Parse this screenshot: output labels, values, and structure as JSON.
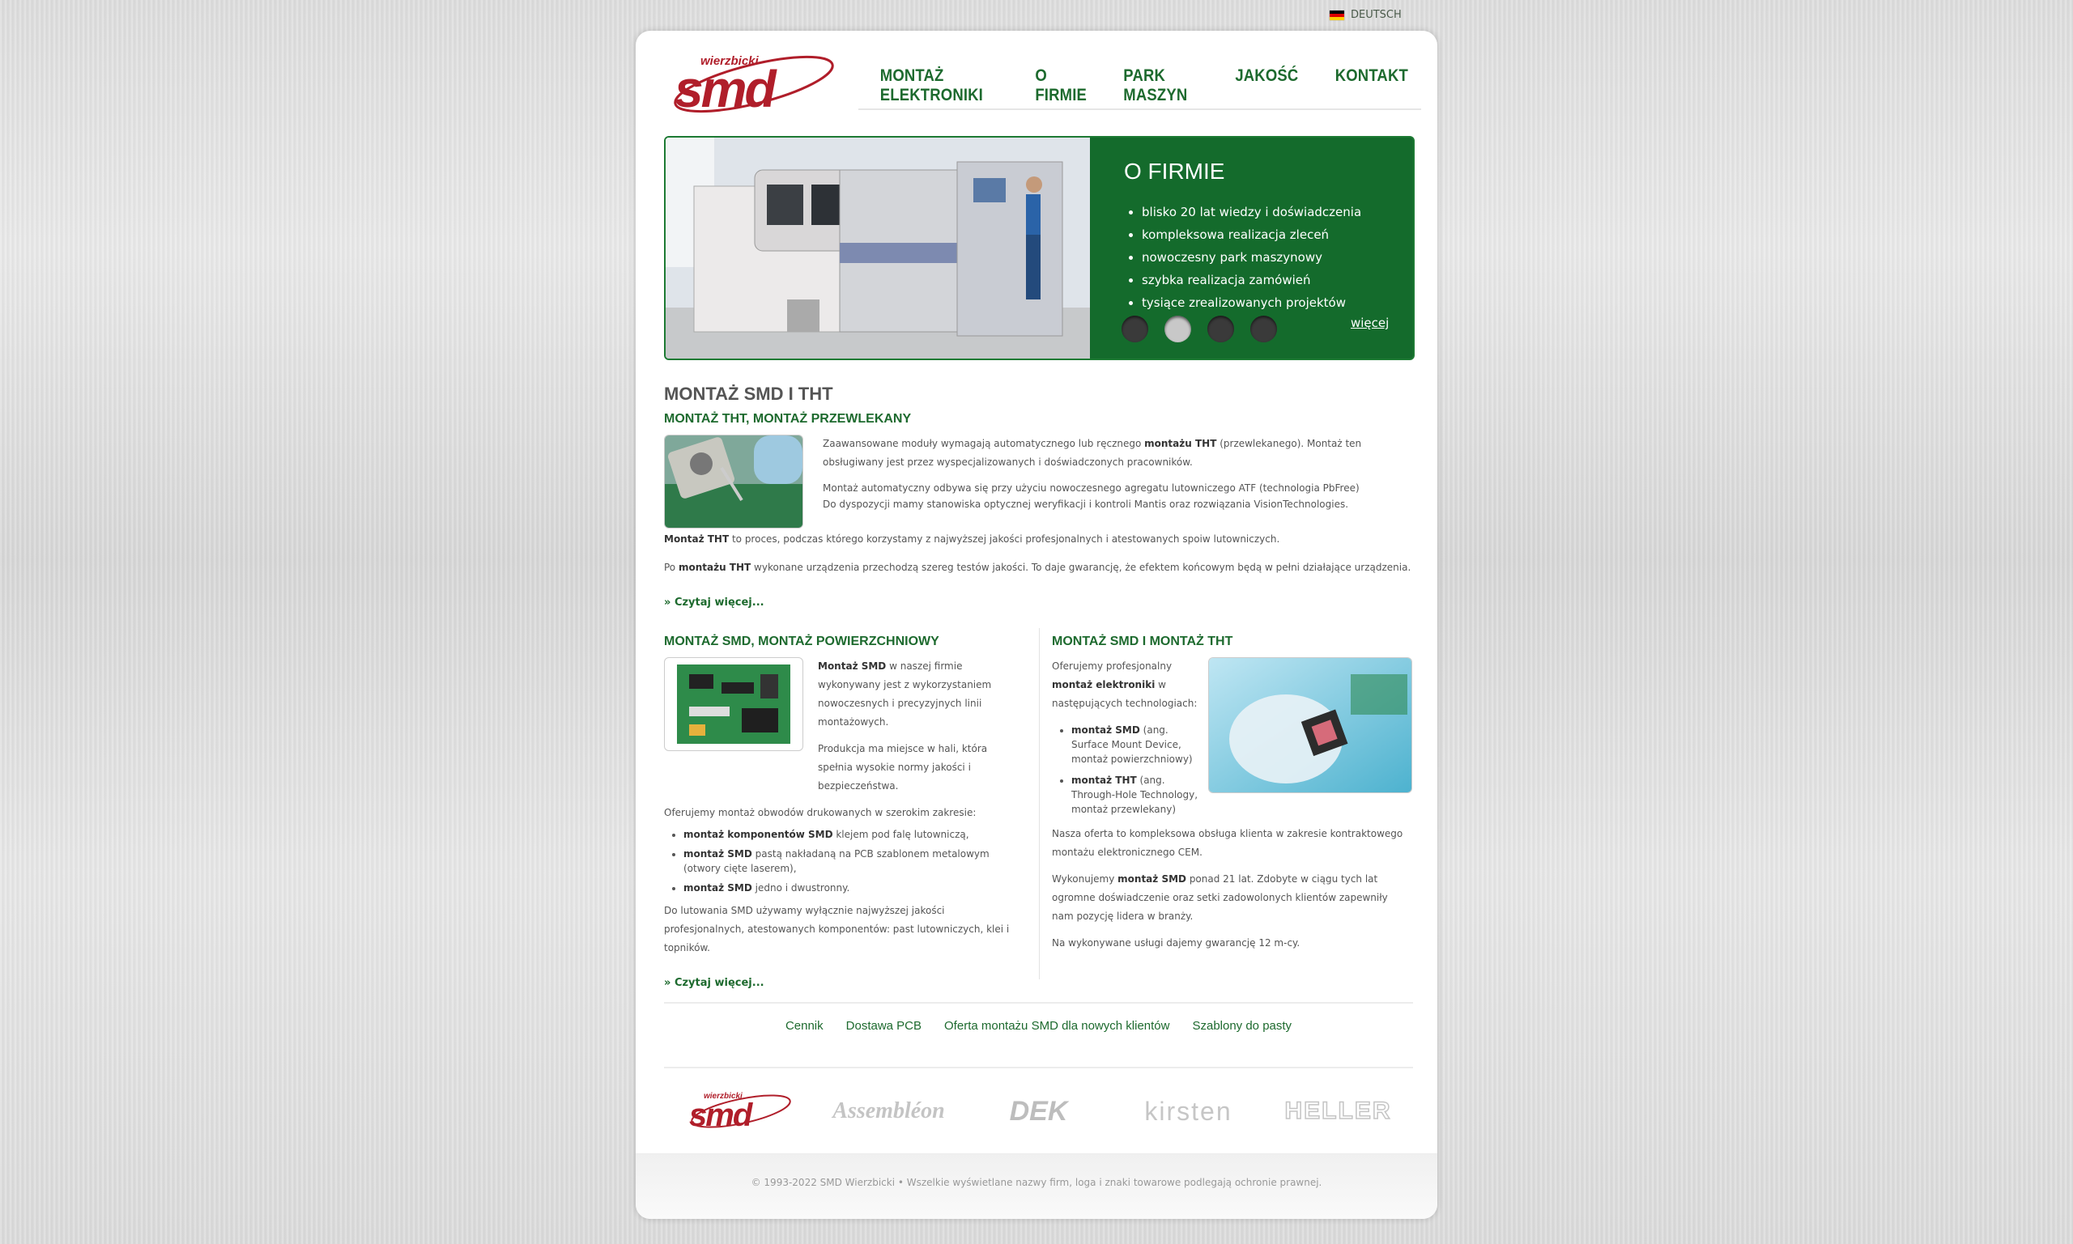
{
  "language": {
    "label": "DEUTSCH",
    "flag_colors": [
      "#000000",
      "#dd0000",
      "#ffce00"
    ]
  },
  "brand": {
    "logo_top": "wierzbicki",
    "logo_main": "smd",
    "accent": "#1d6a2e",
    "logo_red": "#b01e2a"
  },
  "nav": [
    {
      "label": "MONTAŻ ELEKTRONIKI"
    },
    {
      "label": "O FIRMIE"
    },
    {
      "label": "PARK MASZYN"
    },
    {
      "label": "JAKOŚĆ"
    },
    {
      "label": "KONTAKT"
    }
  ],
  "banner": {
    "title": "O FIRMIE",
    "items": [
      "blisko 20 lat wiedzy i doświadczenia",
      "kompleksowa realizacja zleceń",
      "nowoczesny park maszynowy",
      "szybka realizacja zamówień",
      "tysiące zrealizowanych projektów"
    ],
    "more": "więcej",
    "slides": 4,
    "active_slide": 2
  },
  "main": {
    "title": "MONTAŻ SMD I THT",
    "tht": {
      "heading": "MONTAŻ THT, MONTAŻ PRZEWLEKANY",
      "p1_a": "Zaawansowane moduły wymagają automatycznego lub ręcznego ",
      "p1_b": "montażu THT",
      "p1_c": " (przewlekanego). Montaż ten obsługiwany jest przez wyspecjalizowanych i doświadczonych pracowników.",
      "p2_a": "Montaż automatyczny odbywa się przy użyciu nowoczesnego agregatu lutowniczego ATF (technologia PbFree)",
      "p2_b": "Do dyspozycji mamy stanowiska optycznej weryfikacji i kontroli Mantis oraz rozwiązania VisionTechnologies.",
      "p3_b": "Montaż THT",
      "p3_c": " to proces, podczas którego korzystamy z najwyższej jakości profesjonalnych i atestowanych spoiw lutowniczych.",
      "p4_a": "Po ",
      "p4_b": "montażu THT",
      "p4_c": " wykonane urządzenia przechodzą szereg testów jakości. To daje gwarancję, że efektem końcowym będą w pełni działające urządzenia.",
      "read_more": "Czytaj więcej..."
    },
    "smd": {
      "heading": "MONTAŻ SMD, MONTAŻ POWIERZCHNIOWY",
      "p1_b": "Montaż SMD",
      "p1_c": " w naszej firmie wykonywany jest z wykorzystaniem nowoczesnych i precyzyjnych linii montażowych.",
      "p2": "Produkcja ma miejsce w hali, która spełnia wysokie normy jakości i bezpieczeństwa.",
      "p3": "Oferujemy montaż obwodów drukowanych w szerokim zakresie:",
      "list": [
        {
          "b": "montaż komponentów SMD",
          "t": " klejem pod falę lutowniczą,"
        },
        {
          "b": "montaż SMD",
          "t": " pastą nakładaną na PCB szablonem metalowym (otwory cięte laserem),"
        },
        {
          "b": "montaż SMD",
          "t": " jedno i dwustronny."
        }
      ],
      "p4": "Do lutowania SMD używamy wyłącznie najwyższej jakości profesjonalnych, atestowanych komponentów: past lutowniczych, klei i topników.",
      "read_more": "Czytaj więcej..."
    },
    "smdtht": {
      "heading": "MONTAŻ SMD I MONTAŻ THT",
      "p1_a": "Oferujemy profesjonalny ",
      "p1_b": "montaż elektroniki",
      "p1_c": " w następujących technologiach:",
      "list": [
        {
          "b": "montaż SMD",
          "t": " (ang. Surface Mount Device, montaż powierzchniowy)"
        },
        {
          "b": "montaż THT",
          "t": " (ang. Through-Hole Technology, montaż przewlekany)"
        }
      ],
      "p2": "Nasza oferta to kompleksowa obsługa klienta w zakresie kontraktowego montażu elektronicznego CEM.",
      "p3_a": "Wykonujemy ",
      "p3_b": "montaż SMD",
      "p3_c": " ponad 21 lat. Zdobyte w ciągu tych lat ogromne doświadczenie oraz setki zadowolonych klientów zapewniły nam pozycję lidera w branży.",
      "p4": "Na wykonywane usługi dajemy gwarancję 12 m-cy."
    }
  },
  "footer": {
    "links": [
      "Cennik",
      "Dostawa PCB",
      "Oferta montażu SMD dla nowych klientów",
      "Szablony do pasty"
    ],
    "partners": [
      "Assembléon",
      "DEK",
      "kirsten",
      "HELLER"
    ],
    "copyright": "© 1993-2022 SMD Wierzbicki • Wszelkie wyświetlane nazwy firm, loga i znaki towarowe podlegają ochronie prawnej."
  }
}
